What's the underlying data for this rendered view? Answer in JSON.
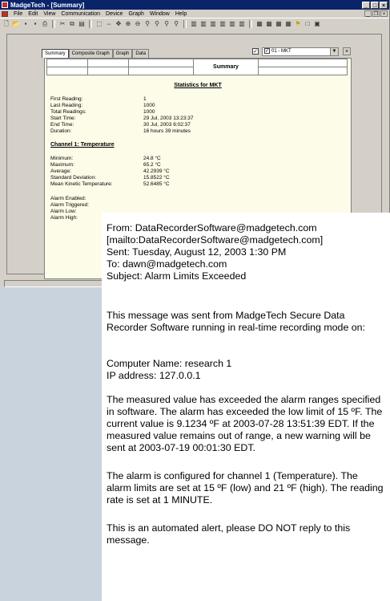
{
  "window": {
    "title": "MadgeTech - [Summary]"
  },
  "menu": [
    "File",
    "Edit",
    "View",
    "Communication",
    "Device",
    "Graph",
    "Window",
    "Help"
  ],
  "toolbar_icons": [
    "new-icon",
    "open-icon",
    "save-icon",
    "save-all-icon",
    "print-icon",
    "cut-icon",
    "copy-icon",
    "paste-icon",
    "select-icon",
    "pan-icon",
    "move-icon",
    "zoom-in-icon",
    "zoom-out-icon",
    "zoom-x-icon",
    "zoom-y-icon",
    "zoom-box-icon",
    "zoom-fit-icon",
    "graph-1-icon",
    "graph-2-icon",
    "graph-3-icon",
    "graph-4-icon",
    "graph-5-icon",
    "graph-6-icon",
    "table-1-icon",
    "table-2-icon",
    "table-3-icon",
    "table-4-icon",
    "flag-icon",
    "window-icon",
    "monitor-icon"
  ],
  "tabs": [
    "Summary",
    "Composite Graph",
    "Graph",
    "Data"
  ],
  "channel_select": {
    "value": "01 - MKT",
    "checked": "✓"
  },
  "report": {
    "header_title": "Summary",
    "stats_title": "Statistics for MKT",
    "general": [
      {
        "label": "First Reading:",
        "value": "1"
      },
      {
        "label": "Last Reading:",
        "value": "1000"
      },
      {
        "label": "Total Readings:",
        "value": "1000"
      },
      {
        "label": "Start Time:",
        "value": "29 Jul, 2003 13:23:37"
      },
      {
        "label": "End Time:",
        "value": "30 Jul, 2003 6:02:37"
      },
      {
        "label": "Duration:",
        "value": "16 hours 39 minutes"
      }
    ],
    "channel_title": "Channel 1: Temperature",
    "channel_stats": [
      {
        "label": "Minimum:",
        "value": "24.8 °C"
      },
      {
        "label": "Maximum:",
        "value": "65.2 °C"
      },
      {
        "label": "Average:",
        "value": "42.2939 °C"
      },
      {
        "label": "Standard Deviation:",
        "value": "15.8522 °C"
      },
      {
        "label": "Mean Kinetic Temperature:",
        "value": "52.6485 °C"
      }
    ],
    "alarm_labels": [
      "Alarm Enabled:",
      "Alarm Triggered:",
      "Alarm Low:",
      "Alarm High:"
    ]
  },
  "email": {
    "header": [
      "From: DataRecorderSoftware@madgetech.com",
      "[mailto:DataRecorderSoftware@madgetech.com]",
      "Sent: Tuesday, August 12, 2003 1:30 PM",
      "To: dawn@madgetech.com",
      "Subject: Alarm Limits Exceeded"
    ],
    "intro": "This message was sent from MadgeTech Secure Data Recorder Software running in real-time recording mode on:",
    "computer_name": "Computer Name: research 1",
    "ip_address": "IP address: 127.0.0.1",
    "alarm_body": "The measured value has exceeded the alarm ranges specified in software. The alarm has exceeded the low limit of 15 ºF. The current value is 9.1234 ºF at 2003-07-28 13:51:39 EDT. If the measured value remains out of range, a new warning will be sent at 2003-07-19 00:01:30 EDT.",
    "config_body": "The alarm is configured for channel 1 (Temperature). The alarm limits are set at 15 ºF (low) and 21 ºF (high). The reading rate is set at 1 MINUTE.",
    "footer": "This is an automated alert, please DO NOT reply to this message."
  }
}
